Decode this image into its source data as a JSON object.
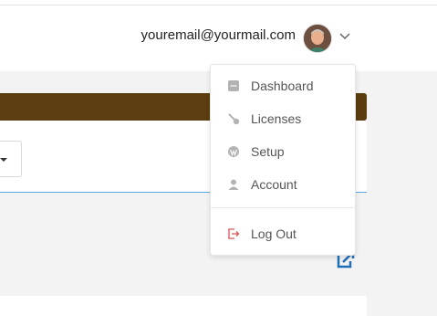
{
  "header": {
    "email": "youremail@yourmail.com",
    "avatar_icon": "user-avatar-photo",
    "dropdown_icon": "chevron-down-icon"
  },
  "menu": {
    "items": [
      {
        "label": "Dashboard",
        "icon": "dashboard-icon"
      },
      {
        "label": "Licenses",
        "icon": "key-icon"
      },
      {
        "label": "Setup",
        "icon": "wordpress-icon"
      },
      {
        "label": "Account",
        "icon": "user-icon"
      },
      {
        "label": "Log Out",
        "icon": "logout-icon",
        "color": "#d9534f"
      }
    ]
  },
  "colors": {
    "accent_bar": "#5b3d10",
    "link_blue": "#1f6fb8",
    "divider_blue": "#5aa9dd"
  }
}
